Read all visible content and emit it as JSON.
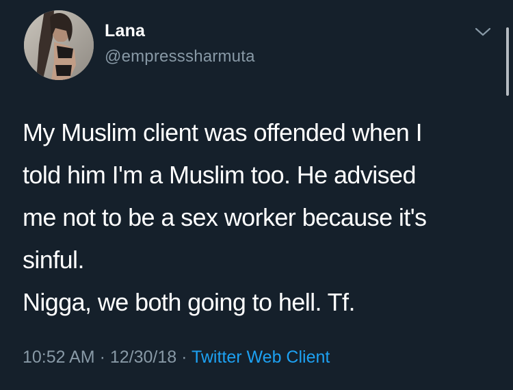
{
  "user": {
    "display_name": "Lana",
    "handle": "@empresssharmuta",
    "avatar_icon": "profile-photo"
  },
  "menu": {
    "icon": "chevron-down-icon"
  },
  "tweet": {
    "lines": [
      "My Muslim client was offended when I",
      "told him I'm a Muslim too. He advised",
      "me not to be a sex worker because it's",
      "sinful.",
      "Nigga, we both going to hell. Tf."
    ]
  },
  "meta": {
    "time": "10:52 AM",
    "separator": " · ",
    "date": "12/30/18",
    "source": "Twitter Web Client"
  },
  "colors": {
    "background": "#15202b",
    "text": "#ffffff",
    "secondary_text": "#8899a6",
    "link": "#1da1f2"
  }
}
